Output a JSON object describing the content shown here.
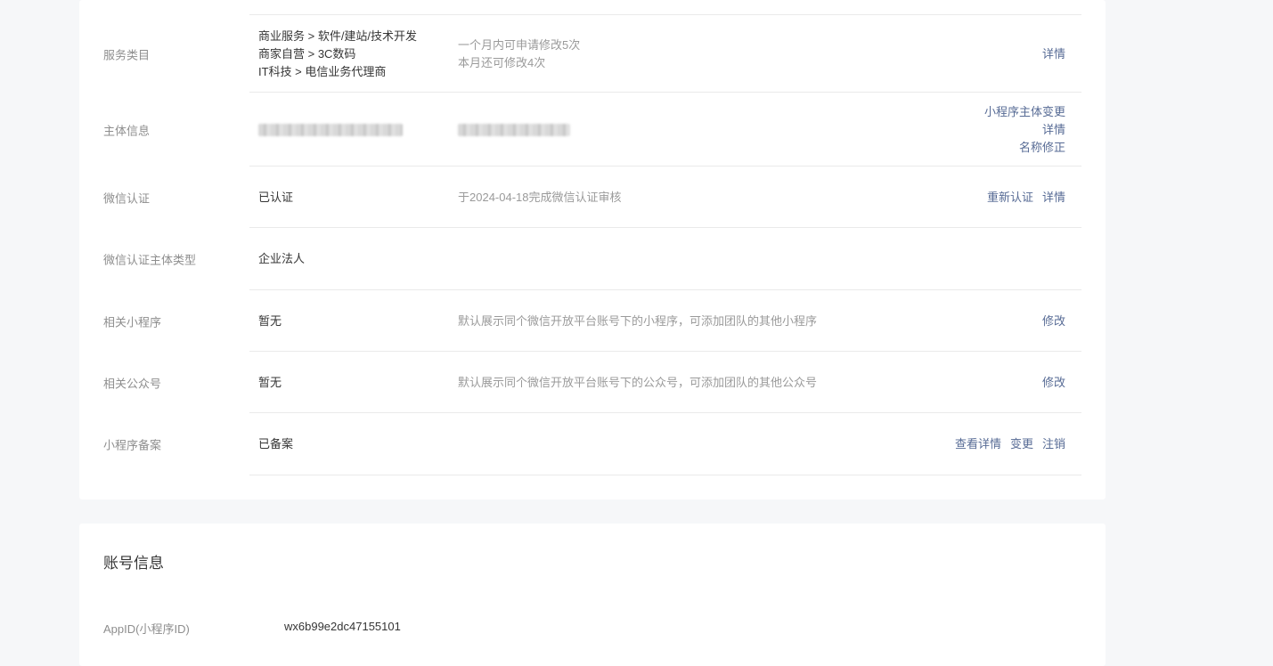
{
  "rows": [
    {
      "label": "服务类目",
      "values": [
        "商业服务 > 软件/建站/技术开发",
        "商家自营 > 3C数码",
        "IT科技 > 电信业务代理商"
      ],
      "hints": [
        "一个月内可申请修改5次",
        "本月还可修改4次"
      ],
      "actions": [
        "详情"
      ]
    },
    {
      "label": "主体信息",
      "actions": [
        "小程序主体变更",
        "详情",
        "名称修正"
      ]
    },
    {
      "label": "微信认证",
      "values": [
        "已认证"
      ],
      "hints": [
        "于2024-04-18完成微信认证审核"
      ],
      "actions": [
        "重新认证",
        "详情"
      ]
    },
    {
      "label": "微信认证主体类型",
      "values": [
        "企业法人"
      ]
    },
    {
      "label": "相关小程序",
      "values": [
        "暂无"
      ],
      "hints": [
        "默认展示同个微信开放平台账号下的小程序，可添加团队的其他小程序"
      ],
      "actions": [
        "修改"
      ]
    },
    {
      "label": "相关公众号",
      "values": [
        "暂无"
      ],
      "hints": [
        "默认展示同个微信开放平台账号下的公众号，可添加团队的其他公众号"
      ],
      "actions": [
        "修改"
      ]
    },
    {
      "label": "小程序备案",
      "values": [
        "已备案"
      ],
      "actions": [
        "查看详情",
        "变更",
        "注销"
      ]
    }
  ],
  "account": {
    "title": "账号信息",
    "appid_label": "AppID(小程序ID)",
    "appid_value": "wx6b99e2dc47155101"
  },
  "colors": {
    "link": "#576b95",
    "label": "#8e8e8e",
    "hint": "#9a9a9a",
    "background": "#f6f7f9"
  }
}
